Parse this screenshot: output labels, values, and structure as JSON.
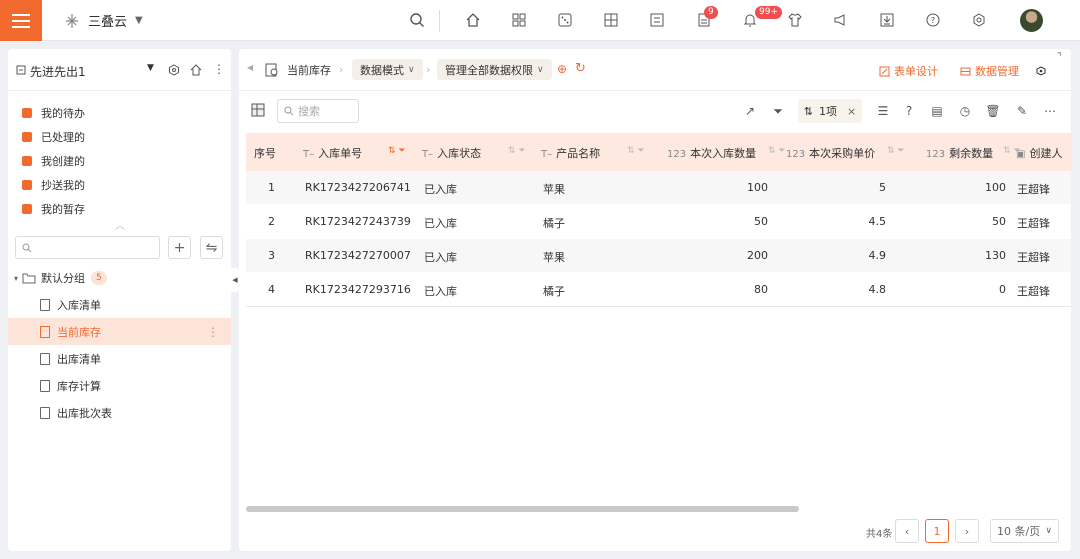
{
  "app": {
    "brand": "三叠云"
  },
  "topbar": {
    "doc_badge": "9",
    "bell_badge": "99+"
  },
  "sidebar": {
    "title": "先进先出1",
    "quick_items": [
      {
        "label": "我的待办"
      },
      {
        "label": "已处理的"
      },
      {
        "label": "我创建的"
      },
      {
        "label": "抄送我的"
      },
      {
        "label": "我的暂存"
      }
    ],
    "group": {
      "label": "默认分组",
      "count": "5"
    },
    "items": [
      {
        "label": "入库清单"
      },
      {
        "label": "当前库存"
      },
      {
        "label": "出库清单"
      },
      {
        "label": "库存计算"
      },
      {
        "label": "出库批次表"
      }
    ]
  },
  "header": {
    "crumb_current": "当前库存",
    "crumb_mode": "数据模式",
    "crumb_perm": "管理全部数据权限",
    "form_design": "表单设计",
    "data_manage": "数据管理"
  },
  "toolbar": {
    "search_placeholder": "搜索",
    "sort_label": "1项"
  },
  "table": {
    "columns": [
      "序号",
      "入库单号",
      "入库状态",
      "产品名称",
      "本次入库数量",
      "本次采购单价",
      "剩余数量",
      "创建人"
    ],
    "rows": [
      [
        "1",
        "RK1723427206741",
        "已入库",
        "苹果",
        "100",
        "5",
        "100",
        "王超锋"
      ],
      [
        "2",
        "RK1723427243739",
        "已入库",
        "橘子",
        "50",
        "4.5",
        "50",
        "王超锋"
      ],
      [
        "3",
        "RK1723427270007",
        "已入库",
        "苹果",
        "200",
        "4.9",
        "130",
        "王超锋"
      ],
      [
        "4",
        "RK1723427293716",
        "已入库",
        "橘子",
        "80",
        "4.8",
        "0",
        "王超锋"
      ]
    ]
  },
  "pager": {
    "total": "共4条",
    "page": "1",
    "page_size": "10 条/页"
  }
}
